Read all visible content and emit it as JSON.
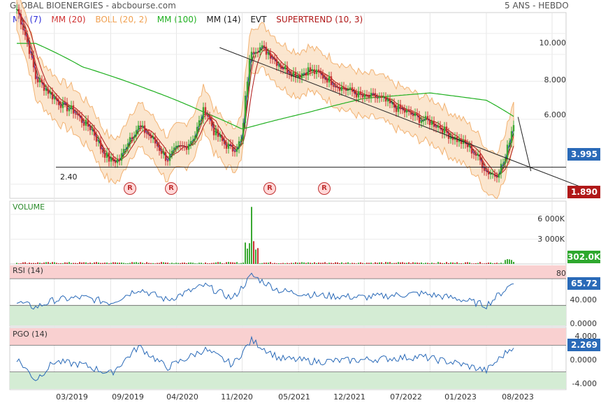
{
  "header": {
    "title": "GLOBAL BIOENERGIES - abcbourse.com",
    "period": "5 ANS - HEBDO"
  },
  "legend": [
    {
      "label": "MM (7)",
      "color": "#2a2ad8"
    },
    {
      "label": "MM (20)",
      "color": "#d03030"
    },
    {
      "label": "BOLL (20, 2)",
      "color": "#f0a050"
    },
    {
      "label": "MM (100)",
      "color": "#20b020"
    },
    {
      "label": "MM (14)",
      "color": "#222222"
    },
    {
      "label": "EVT",
      "color": "#222222"
    },
    {
      "label": "SUPERTREND (10, 3)",
      "color": "#b01818"
    }
  ],
  "colors": {
    "up": "#3aa832",
    "down": "#c83232",
    "rsi_line": "#2a6ab8",
    "rsi_zone_high": "#f9d0d0",
    "rsi_zone_low": "#d4ecd4",
    "badge_price": "#2a6ab8",
    "badge_support": "#b01818",
    "badge_volume": "#2ea82e"
  },
  "x_axis_labels": [
    "03/2019",
    "09/2019",
    "04/2020",
    "11/2020",
    "05/2021",
    "12/2021",
    "07/2022",
    "01/2023",
    "08/2023"
  ],
  "chart_data": [
    {
      "type": "candlestick",
      "title": "GLOBAL BIOENERGIES",
      "period": "5 ANS - HEBDO",
      "scale": "log",
      "y_ticks": [
        10.0,
        8.0,
        6.0,
        4.0,
        2.0
      ],
      "y_tick_labels": [
        "10.000",
        "8.000",
        "6.000",
        "",
        ""
      ],
      "last_price": 3.995,
      "last_price_label": "3.995",
      "support_value": 1.89,
      "support_label": "1.890",
      "horizontal_line": {
        "value": 2.4,
        "label": "2.40"
      },
      "markers": [
        {
          "label": "R",
          "date": "09/2019"
        },
        {
          "label": "R",
          "date": "03/2020"
        },
        {
          "label": "R",
          "date": "01/2021"
        },
        {
          "label": "R",
          "date": "09/2021"
        }
      ],
      "close_series_approx": [
        {
          "date": "11/2018",
          "value": 13.0
        },
        {
          "date": "12/2018",
          "value": 9.5
        },
        {
          "date": "01/2019",
          "value": 6.2
        },
        {
          "date": "02/2019",
          "value": 5.6
        },
        {
          "date": "03/2019",
          "value": 5.0
        },
        {
          "date": "04/2019",
          "value": 4.6
        },
        {
          "date": "05/2019",
          "value": 4.4
        },
        {
          "date": "06/2019",
          "value": 3.9
        },
        {
          "date": "07/2019",
          "value": 3.6
        },
        {
          "date": "08/2019",
          "value": 2.9
        },
        {
          "date": "09/2019",
          "value": 2.55
        },
        {
          "date": "10/2019",
          "value": 2.6
        },
        {
          "date": "11/2019",
          "value": 3.3
        },
        {
          "date": "12/2019",
          "value": 3.7
        },
        {
          "date": "01/2020",
          "value": 3.4
        },
        {
          "date": "02/2020",
          "value": 3.0
        },
        {
          "date": "03/2020",
          "value": 2.6
        },
        {
          "date": "04/2020",
          "value": 2.9
        },
        {
          "date": "05/2020",
          "value": 3.0
        },
        {
          "date": "06/2020",
          "value": 3.4
        },
        {
          "date": "07/2020",
          "value": 4.5
        },
        {
          "date": "08/2020",
          "value": 3.5
        },
        {
          "date": "09/2020",
          "value": 3.1
        },
        {
          "date": "10/2020",
          "value": 2.9
        },
        {
          "date": "11/2020",
          "value": 3.2
        },
        {
          "date": "12/2020",
          "value": 8.5
        },
        {
          "date": "01/2021",
          "value": 8.6
        },
        {
          "date": "02/2021",
          "value": 8.0
        },
        {
          "date": "03/2021",
          "value": 7.1
        },
        {
          "date": "04/2021",
          "value": 6.7
        },
        {
          "date": "05/2021",
          "value": 6.4
        },
        {
          "date": "06/2021",
          "value": 6.8
        },
        {
          "date": "07/2021",
          "value": 6.5
        },
        {
          "date": "08/2021",
          "value": 6.2
        },
        {
          "date": "09/2021",
          "value": 5.8
        },
        {
          "date": "10/2021",
          "value": 5.5
        },
        {
          "date": "11/2021",
          "value": 5.3
        },
        {
          "date": "12/2021",
          "value": 5.0
        },
        {
          "date": "01/2022",
          "value": 5.1
        },
        {
          "date": "02/2022",
          "value": 4.9
        },
        {
          "date": "03/2022",
          "value": 4.6
        },
        {
          "date": "04/2022",
          "value": 4.4
        },
        {
          "date": "05/2022",
          "value": 4.2
        },
        {
          "date": "06/2022",
          "value": 4.0
        },
        {
          "date": "07/2022",
          "value": 3.9
        },
        {
          "date": "08/2022",
          "value": 3.7
        },
        {
          "date": "09/2022",
          "value": 3.4
        },
        {
          "date": "10/2022",
          "value": 3.2
        },
        {
          "date": "11/2022",
          "value": 3.0
        },
        {
          "date": "12/2022",
          "value": 2.7
        },
        {
          "date": "01/2023",
          "value": 2.3
        },
        {
          "date": "02/2023",
          "value": 2.2
        },
        {
          "date": "03/2023",
          "value": 2.6
        },
        {
          "date": "04/2023",
          "value": 3.995
        }
      ],
      "mm100_approx": [
        {
          "date": "01/2019",
          "value": 9.0
        },
        {
          "date": "06/2019",
          "value": 7.0
        },
        {
          "date": "01/2020",
          "value": 5.5
        },
        {
          "date": "07/2020",
          "value": 4.3
        },
        {
          "date": "11/2020",
          "value": 3.6
        },
        {
          "date": "06/2021",
          "value": 4.3
        },
        {
          "date": "12/2021",
          "value": 5.0
        },
        {
          "date": "07/2022",
          "value": 5.3
        },
        {
          "date": "01/2023",
          "value": 4.9
        },
        {
          "date": "04/2023",
          "value": 4.1
        }
      ]
    },
    {
      "type": "bar",
      "title": "VOLUME",
      "y_ticks": [
        6000,
        3000
      ],
      "y_tick_labels": [
        "6 000K",
        "3 000K"
      ],
      "last_value": 302.0,
      "last_value_label": "302.0K",
      "peak": {
        "date": "12/2020",
        "value": 6900
      }
    },
    {
      "type": "line",
      "title": "RSI (14)",
      "y_ticks": [
        80,
        40,
        0
      ],
      "y_tick_labels": [
        "80",
        "40.000",
        "0.0000"
      ],
      "zones": {
        "high": 70,
        "low": 30
      },
      "last_value": 65.72,
      "last_value_label": "65.72",
      "series_approx": [
        {
          "date": "11/2018",
          "value": 35
        },
        {
          "date": "01/2019",
          "value": 27
        },
        {
          "date": "03/2019",
          "value": 38
        },
        {
          "date": "06/2019",
          "value": 42
        },
        {
          "date": "09/2019",
          "value": 34
        },
        {
          "date": "12/2019",
          "value": 55
        },
        {
          "date": "03/2020",
          "value": 38
        },
        {
          "date": "07/2020",
          "value": 60
        },
        {
          "date": "10/2020",
          "value": 40
        },
        {
          "date": "12/2020",
          "value": 75
        },
        {
          "date": "03/2021",
          "value": 52
        },
        {
          "date": "07/2021",
          "value": 45
        },
        {
          "date": "12/2021",
          "value": 42
        },
        {
          "date": "06/2022",
          "value": 48
        },
        {
          "date": "10/2022",
          "value": 40
        },
        {
          "date": "01/2023",
          "value": 30
        },
        {
          "date": "04/2023",
          "value": 65.72
        }
      ]
    },
    {
      "type": "line",
      "title": "PGO (14)",
      "y_ticks": [
        4.0,
        0.0,
        -4.0
      ],
      "y_tick_labels": [
        "4.000",
        "0.0000",
        "-4.000"
      ],
      "zones": {
        "high": 2.2,
        "low": -2.2
      },
      "last_value": 2.269,
      "last_value_label": "2.269",
      "series_approx": [
        {
          "date": "11/2018",
          "value": 0.0
        },
        {
          "date": "01/2019",
          "value": -3.5
        },
        {
          "date": "03/2019",
          "value": -0.5
        },
        {
          "date": "06/2019",
          "value": -1.0
        },
        {
          "date": "09/2019",
          "value": -2.5
        },
        {
          "date": "12/2019",
          "value": 2.0
        },
        {
          "date": "03/2020",
          "value": -1.5
        },
        {
          "date": "07/2020",
          "value": 1.5
        },
        {
          "date": "10/2020",
          "value": -1.0
        },
        {
          "date": "12/2020",
          "value": 3.0
        },
        {
          "date": "03/2021",
          "value": 0.0
        },
        {
          "date": "07/2021",
          "value": -0.5
        },
        {
          "date": "12/2021",
          "value": -0.2
        },
        {
          "date": "06/2022",
          "value": 0.3
        },
        {
          "date": "10/2022",
          "value": -0.8
        },
        {
          "date": "01/2023",
          "value": -2.0
        },
        {
          "date": "04/2023",
          "value": 2.269
        }
      ]
    }
  ]
}
